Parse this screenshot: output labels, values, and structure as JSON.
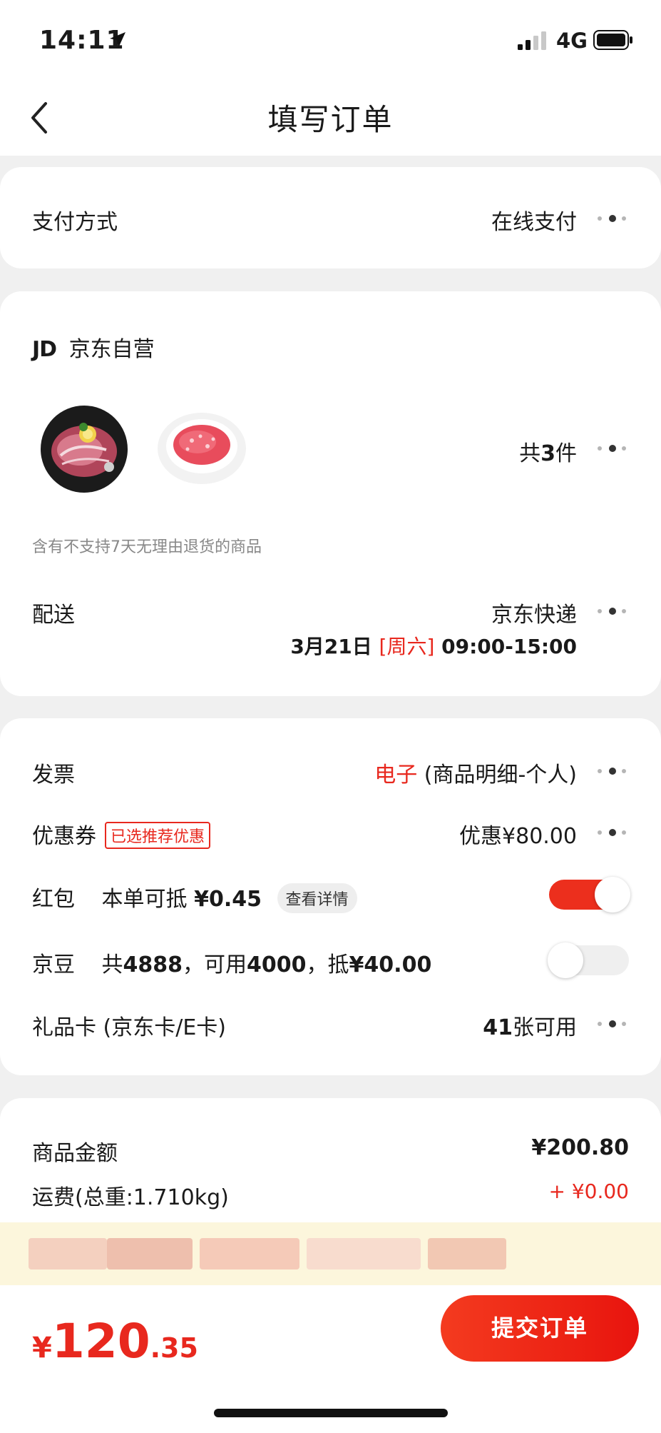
{
  "status_bar": {
    "time": "14:11",
    "network": "4G"
  },
  "nav": {
    "title": "填写订单"
  },
  "payment": {
    "label": "支付方式",
    "value": "在线支付"
  },
  "shop": {
    "logo": "JD",
    "name": "京东自营",
    "count_prefix": "共",
    "count": "3",
    "count_suffix": "件",
    "notice": "含有不支持7天无理由退货的商品",
    "delivery_label": "配送",
    "delivery_method": "京东快递",
    "delivery_date": "3月21日",
    "delivery_weekday": "[周六]",
    "delivery_time": "09:00-15:00"
  },
  "benefits": {
    "invoice_label": "发票",
    "invoice_type": "电子",
    "invoice_detail": "(商品明细-个人)",
    "coupon_label": "优惠券",
    "coupon_tag": "已选推荐优惠",
    "coupon_value": "优惠¥80.00",
    "redpacket_label": "红包",
    "redpacket_text": "本单可抵",
    "redpacket_amount": "¥0.45",
    "redpacket_detail": "查看详情",
    "redpacket_on": true,
    "beans_label": "京豆",
    "beans_text_1": "共",
    "beans_total": "4888",
    "beans_text_2": "，可用",
    "beans_usable": "4000",
    "beans_text_3": "，抵",
    "beans_amount": "¥40.00",
    "beans_on": false,
    "giftcard_label": "礼品卡 (京东卡/E卡)",
    "giftcard_count": "41",
    "giftcard_suffix": "张可用"
  },
  "amounts": {
    "goods_label": "商品金额",
    "goods_value": "¥200.80",
    "shipping_label": "运费(总重:1.710kg)",
    "shipping_value": "+ ¥0.00"
  },
  "footer": {
    "currency": "¥",
    "total_int": "120",
    "total_dec": ".35",
    "submit_label": "提交订单"
  },
  "colors": {
    "accent": "#e8281e",
    "banner": "#fcf6dc",
    "background": "#f0f0f0"
  },
  "icons": [
    "location-arrow-icon",
    "signal-icon",
    "battery-icon",
    "back-chevron-icon",
    "more-dots-icon",
    "jd-logo-icon"
  ]
}
